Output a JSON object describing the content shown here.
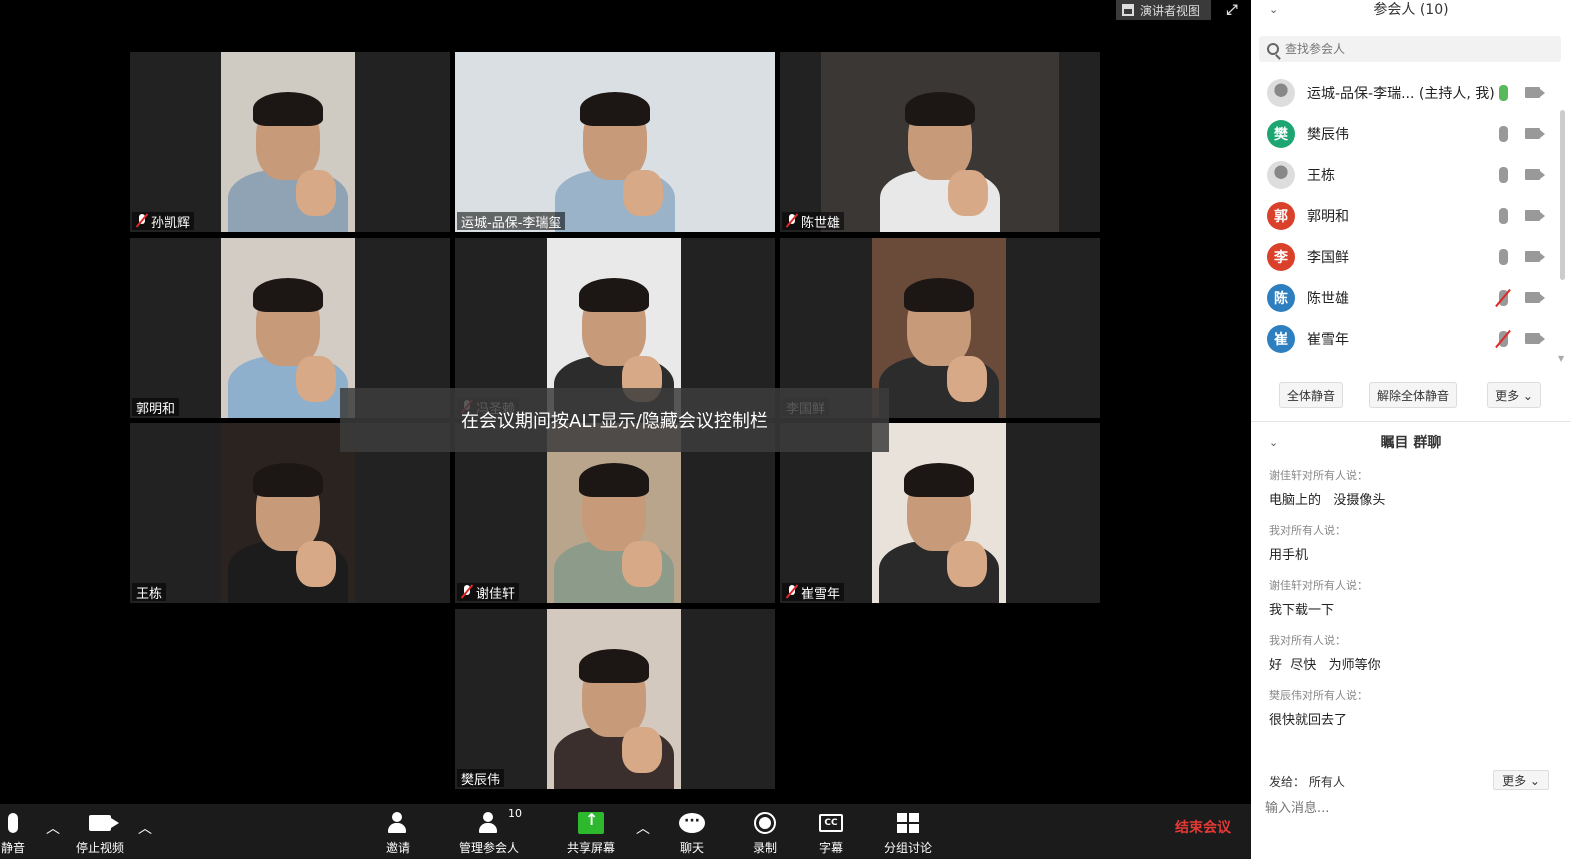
{
  "top": {
    "speaker_view": "演讲者视图"
  },
  "tiles": [
    {
      "name": "孙凯辉",
      "muted": true,
      "active": false,
      "bg": "#cfcac2",
      "shirt": "#8fa3b5"
    },
    {
      "name": "运城-品保-李瑞玺",
      "muted": false,
      "active": true,
      "bg": "#d9dfe2",
      "shirt": "#9ab3c8"
    },
    {
      "name": "陈世雄",
      "muted": true,
      "active": false,
      "bg": "#3a3735",
      "shirt": "#e8e8e8"
    },
    {
      "name": "郭明和",
      "muted": false,
      "active": false,
      "bg": "#d2ccc4",
      "shirt": "#8fb0cc"
    },
    {
      "name": "冯圣赖",
      "muted": true,
      "active": false,
      "bg": "#e9e9e9",
      "shirt": "#2c2c2c"
    },
    {
      "name": "李国鲜",
      "muted": false,
      "active": false,
      "bg": "#6a4b3a",
      "shirt": "#2c2c2c"
    },
    {
      "name": "王栋",
      "muted": false,
      "active": false,
      "bg": "#2a2320",
      "shirt": "#1c1c1c"
    },
    {
      "name": "谢佳轩",
      "muted": true,
      "active": false,
      "bg": "#b9a48c",
      "shirt": "#8d9c8a"
    },
    {
      "name": "崔雪年",
      "muted": true,
      "active": false,
      "bg": "#e8e2da",
      "shirt": "#2a2a2a"
    },
    {
      "name": "樊辰伟",
      "muted": false,
      "active": false,
      "bg": "#d3c9bf",
      "shirt": "#3a2f2c"
    }
  ],
  "alt_tip": "在会议期间按ALT显示/隐藏会议控制栏",
  "toolbar": {
    "mute": "静音",
    "stop_video": "停止视频",
    "invite": "邀请",
    "manage_participants": "管理参会人",
    "participant_count": "10",
    "share_screen": "共享屏幕",
    "chat": "聊天",
    "record": "录制",
    "captions": "字幕",
    "breakout": "分组讨论",
    "end_meeting": "结束会议"
  },
  "participants_panel": {
    "title": "参会人 (10)",
    "search_placeholder": "查找参会人",
    "items": [
      {
        "name": "运城-品保-李瑞...  (主持人, 我)",
        "initial": "",
        "avatar_color": "#ffffff",
        "mic": "on"
      },
      {
        "name": "樊辰伟",
        "initial": "樊",
        "avatar_color": "#1ea672",
        "mic": "idle"
      },
      {
        "name": "王栋",
        "initial": "",
        "avatar_color": "#777777",
        "mic": "idle"
      },
      {
        "name": "郭明和",
        "initial": "郭",
        "avatar_color": "#d9412b",
        "mic": "idle"
      },
      {
        "name": "李国鲜",
        "initial": "李",
        "avatar_color": "#d9412b",
        "mic": "idle"
      },
      {
        "name": "陈世雄",
        "initial": "陈",
        "avatar_color": "#2e7fc0",
        "mic": "muted"
      },
      {
        "name": "崔雪年",
        "initial": "崔",
        "avatar_color": "#2e7fc0",
        "mic": "muted"
      }
    ],
    "mute_all": "全体静音",
    "unmute_all": "解除全体静音",
    "more": "更多 ⌄"
  },
  "chat_panel": {
    "title": "瞩目 群聊",
    "messages": [
      {
        "from": "谢佳轩对所有人说：",
        "text": "电脑上的   没摄像头"
      },
      {
        "from": "我对所有人说：",
        "text": "用手机"
      },
      {
        "from": "谢佳轩对所有人说：",
        "text": "我下载一下"
      },
      {
        "from": "我对所有人说：",
        "text": "好  尽快   为师等你"
      },
      {
        "from": "樊辰伟对所有人说：",
        "text": "很快就回去了"
      }
    ],
    "send_to_label": "发给：",
    "send_to_value": "所有人",
    "more": "更多 ⌄",
    "input_placeholder": "输入消息..."
  }
}
